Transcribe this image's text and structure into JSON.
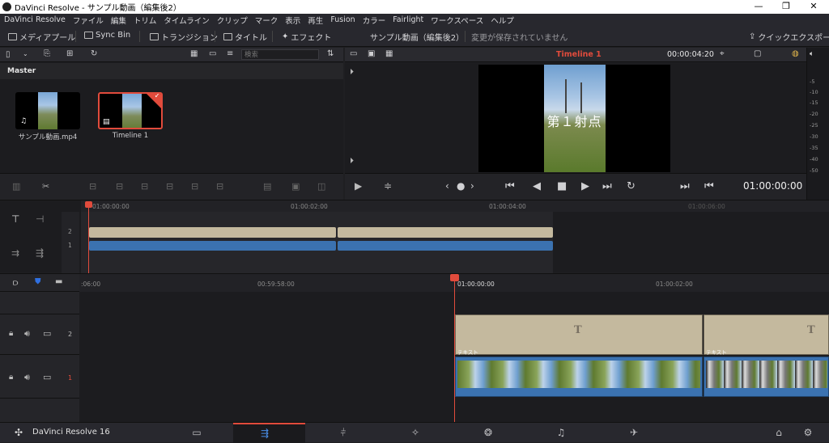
{
  "window": {
    "title": "DaVinci Resolve - サンプル動画（編集後2）",
    "minimize": "—",
    "maximize": "❐",
    "close": "✕"
  },
  "menu": [
    "DaVinci Resolve",
    "ファイル",
    "編集",
    "トリム",
    "タイムライン",
    "クリップ",
    "マーク",
    "表示",
    "再生",
    "Fusion",
    "カラー",
    "Fairlight",
    "ワークスペース",
    "ヘルプ"
  ],
  "toolbar": {
    "media_pool": "メディアプール",
    "sync_bin": "Sync Bin",
    "transitions": "トランジション",
    "titles": "タイトル",
    "effects": "エフェクト",
    "project_name": "サンプル動画（編集後2）",
    "save_status": "変更が保存されていません",
    "quick_export": "クイックエクスポート"
  },
  "media_pool": {
    "search_placeholder": "検索",
    "bin_name": "Master",
    "clips": [
      {
        "name": "サンプル動画.mp4",
        "kind": "audio-video",
        "selected": false
      },
      {
        "name": "Timeline 1",
        "kind": "timeline",
        "selected": true
      }
    ]
  },
  "viewer": {
    "timeline_name": "Timeline 1",
    "duration": "00:00:04:20",
    "overlay_text": "第１射点",
    "timecode": "01:00:00:00"
  },
  "audio_meter": {
    "ticks": [
      "-5",
      "-10",
      "-15",
      "-20",
      "-25",
      "-30",
      "-35",
      "-40",
      "-50"
    ]
  },
  "upper_timeline": {
    "ruler": [
      "01:00:00:00",
      "01:00:02:00",
      "01:00:04:00",
      "01:00:06:00"
    ],
    "tracks": [
      "2",
      "1"
    ]
  },
  "lower_timeline": {
    "ruler": [
      "00:59:58:00",
      "01:00:00:00",
      "01:00:02:00"
    ],
    "tracks": [
      {
        "number": "2",
        "clip_label": "テキスト"
      },
      {
        "number": "1",
        "clip_label": ""
      }
    ],
    "title_clip_glyph": "T"
  },
  "footer": {
    "app_name": "DaVinci Resolve 16"
  },
  "colors": {
    "accent_red": "#e14b3c",
    "text_clip": "#c4b99e",
    "video_clip": "#3b72b0",
    "selected_page": "#e14b3c"
  }
}
